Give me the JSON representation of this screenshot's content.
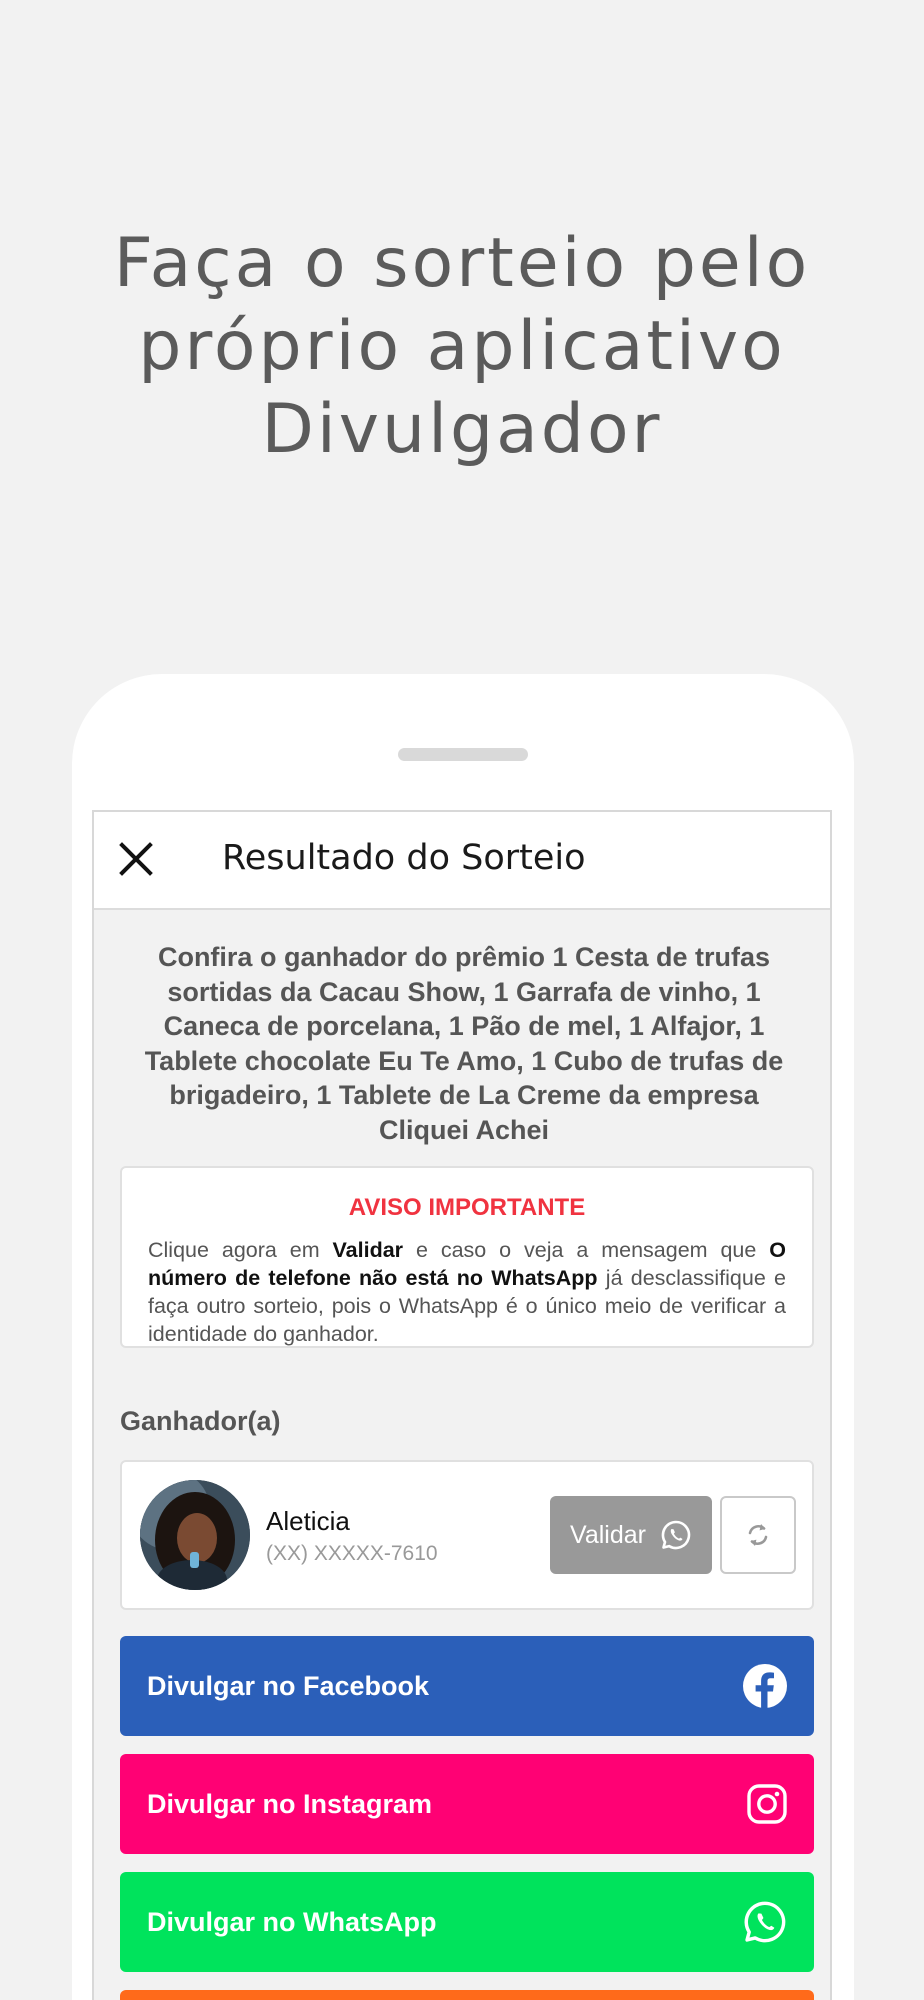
{
  "headline": {
    "line1": "Faça o sorteio pelo",
    "line2": "próprio aplicativo",
    "line3": "Divulgador"
  },
  "appbar": {
    "title": "Resultado do Sorteio"
  },
  "intro": "Confira o ganhador do prêmio 1 Cesta de trufas sortidas da Cacau Show, 1 Garrafa de vinho, 1 Caneca de porcelana, 1 Pão de mel, 1 Alfajor, 1 Tablete chocolate Eu Te Amo, 1 Cubo de trufas de brigadeiro, 1 Tablete de La Creme da empresa Cliquei Achei",
  "notice": {
    "title": "AVISO IMPORTANTE",
    "part1": "Clique agora em ",
    "bold1": "Validar",
    "part2": " e caso o veja a mensagem que ",
    "bold2": "O número de telefone não está no WhatsApp",
    "part3": " já desclassifique e faça outro sorteio, pois o WhatsApp é o único meio de verificar a identidade do ganhador."
  },
  "winner": {
    "label": "Ganhador(a)",
    "name": "Aleticia",
    "phone": "(XX) XXXXX-7610",
    "validate_label": "Validar"
  },
  "share": {
    "facebook": "Divulgar no Facebook",
    "instagram": "Divulgar no Instagram",
    "whatsapp": "Divulgar no WhatsApp"
  },
  "colors": {
    "facebook": "#2b5fb9",
    "instagram": "#ff0174",
    "whatsapp": "#00e35c",
    "more": "#ff6a1a",
    "notice_title": "#f03340",
    "validate": "#999999"
  },
  "icons": {
    "close": "close-icon",
    "whatsapp": "whatsapp-icon",
    "refresh": "refresh-icon",
    "facebook": "facebook-icon",
    "instagram": "instagram-icon"
  }
}
